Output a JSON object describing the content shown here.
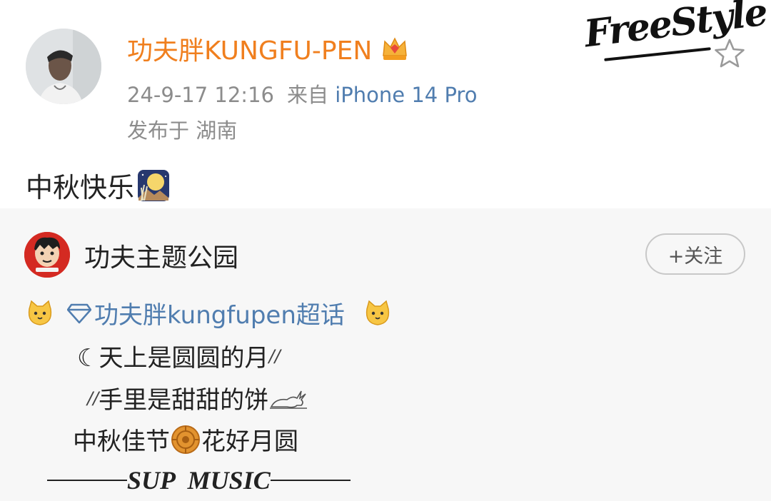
{
  "post": {
    "author_name": "功夫胖KUNGFU-PEN",
    "timestamp": "24-9-17 12:16",
    "source_prefix": "来自",
    "device": "iPhone 14 Pro",
    "location": "发布于 湖南",
    "text": "中秋快乐",
    "logo_text": "FreeStyle"
  },
  "repost": {
    "author_name": "功夫主题公园",
    "follow_label": "+关注",
    "topic": "功夫胖kungfupen超话",
    "line1": "☾天上是圆圆的月",
    "line1_suffix": "//",
    "line2_prefix": "//",
    "line2": "手里是甜甜的饼",
    "line3_a": "中秋佳节",
    "line3_b": "花好月圆",
    "signature": "SUP  MUSIC"
  },
  "icons": {
    "badge": "crown-icon",
    "favorite": "star-outline-icon",
    "post_emoji": "moon-viewing-icon",
    "topic": "diamond-icon",
    "cat": "cat-face-icon",
    "mooncake": "mooncake-icon",
    "rabbit": "rabbit-icon"
  },
  "colors": {
    "author_name": "#f07f1e",
    "link": "#507daf",
    "meta": "#8c8c8c",
    "card_bg": "#f7f7f7",
    "repost_avatar": "#d42a22"
  }
}
